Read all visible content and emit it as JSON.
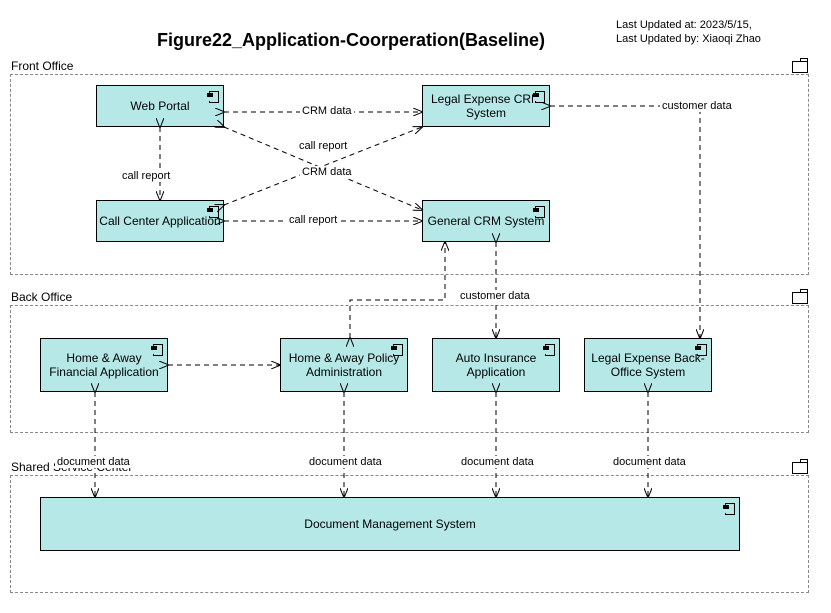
{
  "header": {
    "title": "Figure22_Application-Coorperation(Baseline)",
    "updated_at": "Last Updated at: 2023/5/15,",
    "updated_by": "Last Updated by: Xiaoqi Zhao"
  },
  "groups": {
    "front": "Front Office",
    "back": "Back Office",
    "shared": "Shared Service Center"
  },
  "apps": {
    "webportal": "Web Portal",
    "callcenter": "Call Center Application",
    "legalcrm": "Legal Expense CRM System",
    "generalcrm": "General CRM System",
    "hafin": "Home & Away Financial Application",
    "hapolicy": "Home & Away Policy Administration",
    "autoins": "Auto Insurance Application",
    "legalbo": "Legal Expense Back-Office System",
    "dms": "Document Management System"
  },
  "edges": {
    "crmdata1": "CRM data",
    "crmdata2": "CRM data",
    "callreport1": "call report",
    "callreport2": "call report",
    "callreport3": "call report",
    "custdata1": "customer data",
    "custdata2": "customer data",
    "doc1": "document data",
    "doc2": "document data",
    "doc3": "document data",
    "doc4": "document data"
  }
}
